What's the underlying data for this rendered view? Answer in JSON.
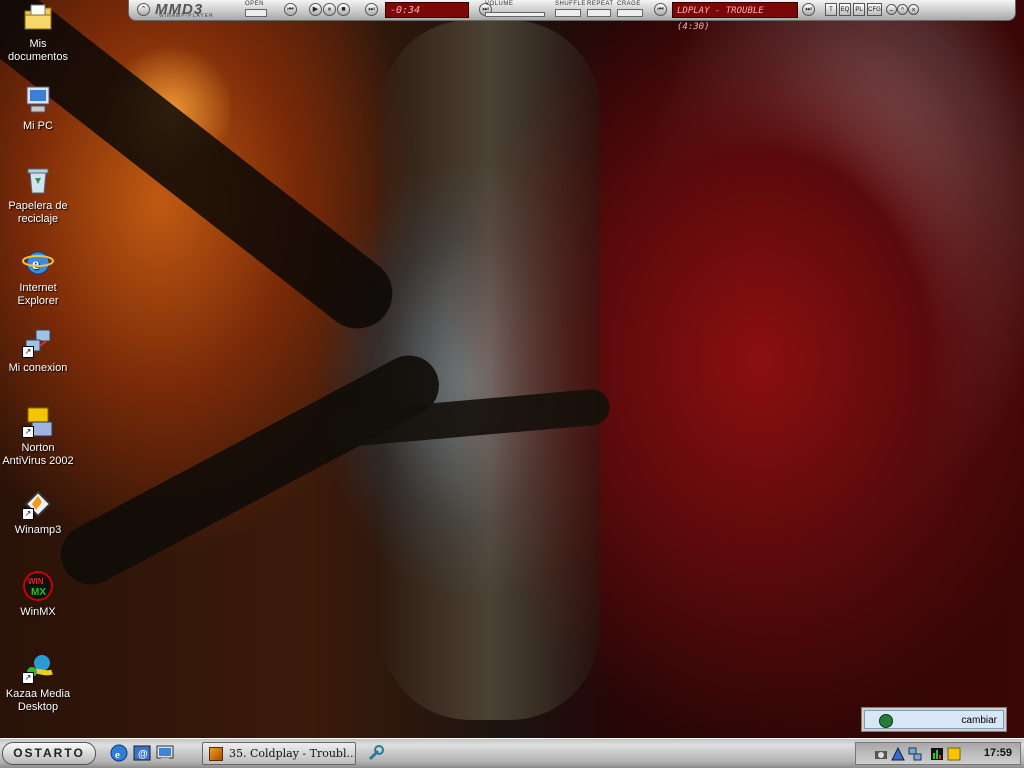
{
  "desktop": {
    "icons": [
      {
        "label": "Mis documentos",
        "icon": "folder-documents-icon"
      },
      {
        "label": "Mi PC",
        "icon": "computer-icon"
      },
      {
        "label": "Papelera de reciclaje",
        "icon": "recycle-bin-icon"
      },
      {
        "label": "Internet Explorer",
        "icon": "internet-explorer-icon"
      },
      {
        "label": "Mi conexion",
        "icon": "network-connection-icon"
      },
      {
        "label": "Norton AntiVirus 2002",
        "icon": "norton-antivirus-icon"
      },
      {
        "label": "Winamp3",
        "icon": "winamp-icon"
      },
      {
        "label": "WinMX",
        "icon": "winmx-icon"
      },
      {
        "label": "Kazaa Media Desktop",
        "icon": "kazaa-icon"
      }
    ]
  },
  "player": {
    "logo": "MMD3",
    "subtitle": "WINAMP-PLAYER",
    "open_label": "OPEN",
    "time": "-0:34",
    "volume_label": "VOLUME",
    "shuffle_label": "SHUFFLE",
    "repeat_label": "REPEAT",
    "crage_label": "CRAGE",
    "song_display": "LDPLAY - TROUBLE (4:30)",
    "buttons": {
      "t": "T",
      "eq": "EQ",
      "pl": "PL",
      "cfg": "CFG"
    }
  },
  "deskbar": {
    "text": "cambiar"
  },
  "taskbar": {
    "start_label": "OSTARTO",
    "task_label": "35. Coldplay - Troubl...",
    "clock": "17:59"
  },
  "colors": {
    "lcd_bg": "#7a0808",
    "lcd_text": "#ffb0b0",
    "taskbar": "#c4c4c4"
  }
}
